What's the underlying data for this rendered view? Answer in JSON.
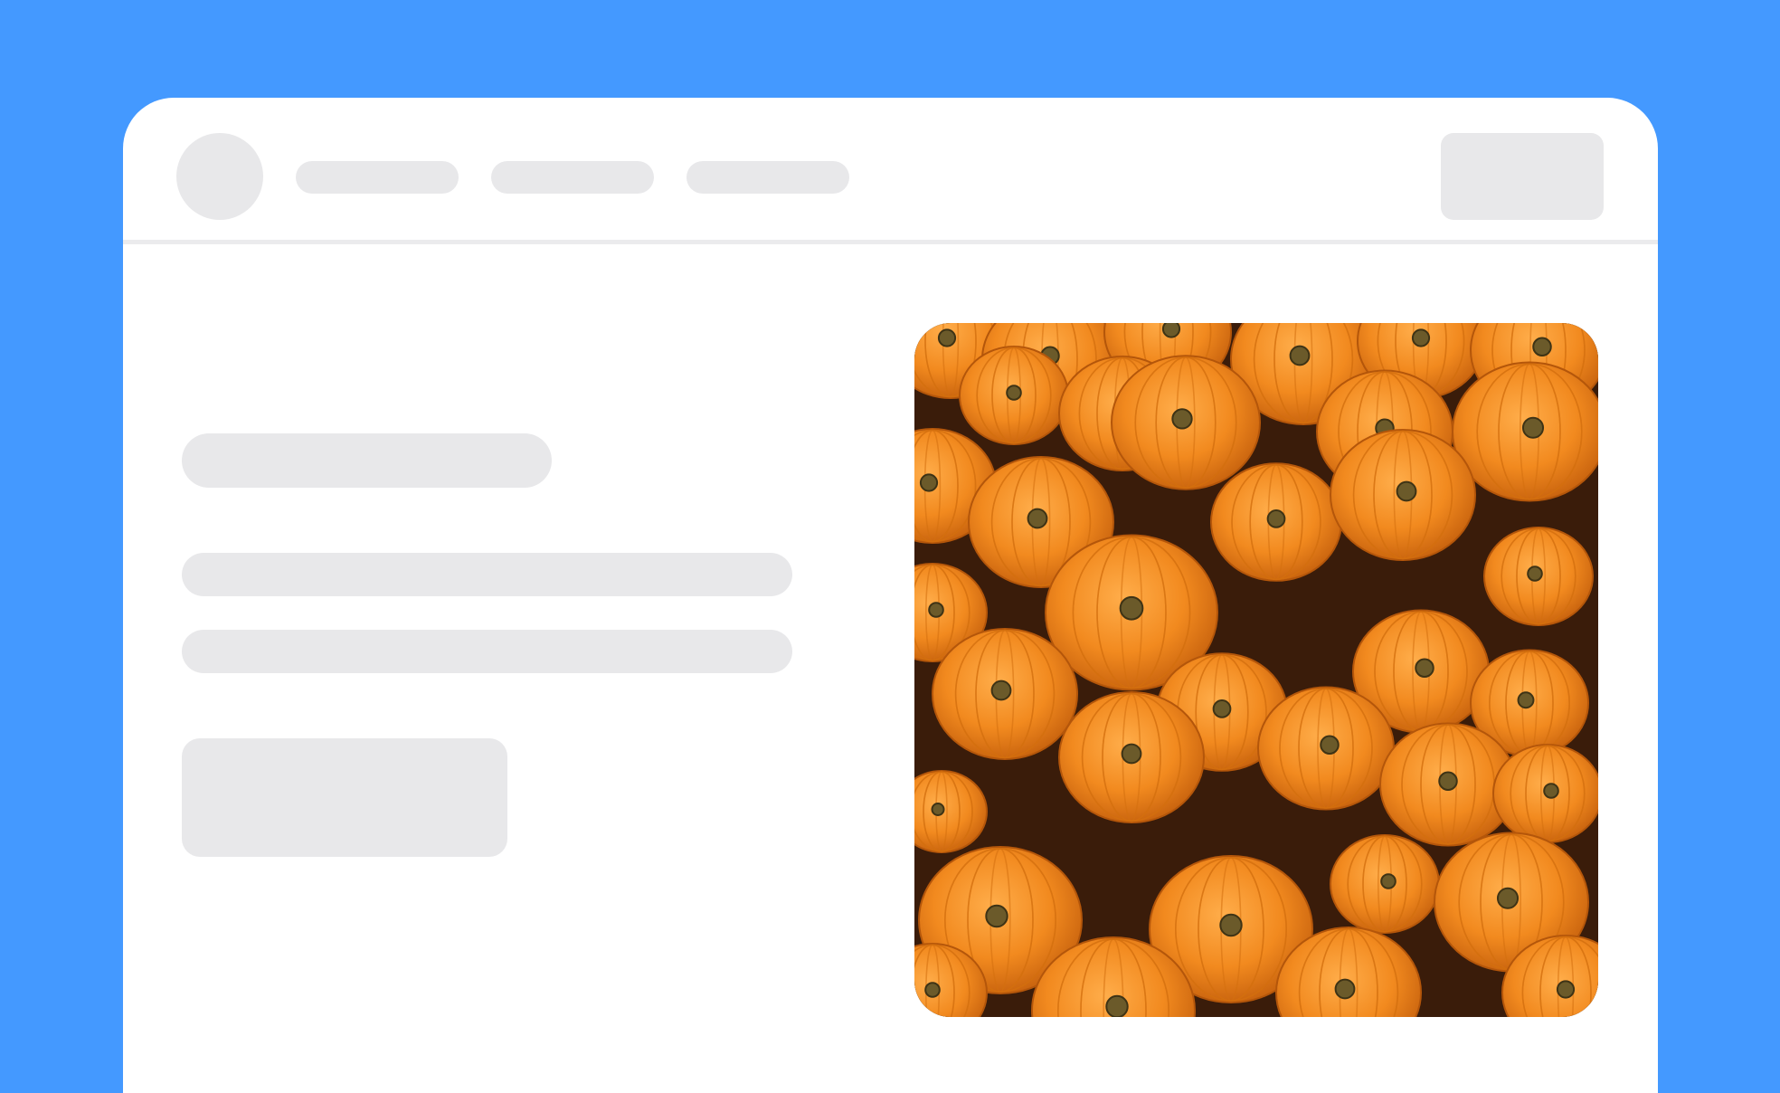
{
  "header": {
    "nav_items": [
      {
        "label": ""
      },
      {
        "label": ""
      },
      {
        "label": ""
      }
    ],
    "action_button_label": ""
  },
  "main": {
    "hero_image": {
      "alt": "",
      "subject_icon": "pumpkin-pile-image"
    }
  },
  "colors": {
    "background": "#4499ff",
    "window": "#ffffff",
    "skeleton": "#e8e8ea",
    "pumpkin": "#f08a1e",
    "pumpkin_dark": "#c9650f",
    "stem": "#6b5a2a"
  }
}
